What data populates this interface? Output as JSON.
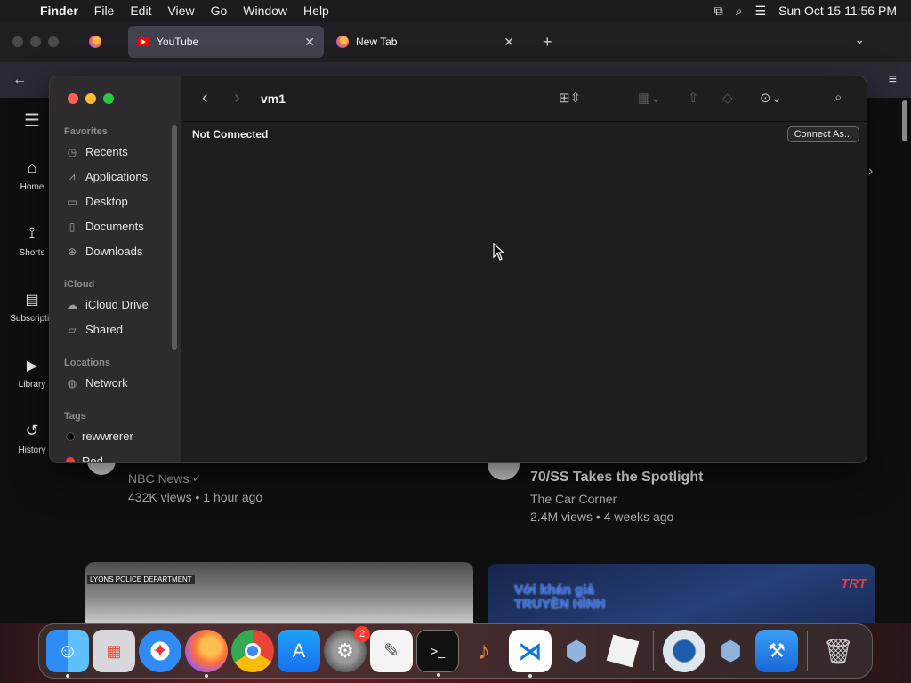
{
  "menubar": {
    "app": "Finder",
    "items": [
      "File",
      "Edit",
      "View",
      "Go",
      "Window",
      "Help"
    ],
    "datetime": "Sun Oct 15  11:56 PM"
  },
  "browser": {
    "tabs": [
      {
        "label": "YouTube",
        "active": true
      },
      {
        "label": "New Tab",
        "active": false
      }
    ]
  },
  "youtube": {
    "sidebar": [
      {
        "label": "Home",
        "icon": "home-icon"
      },
      {
        "label": "Shorts",
        "icon": "shorts-icon"
      },
      {
        "label": "Subscriptio",
        "icon": "subscriptions-icon"
      },
      {
        "label": "Library",
        "icon": "library-icon"
      },
      {
        "label": "History",
        "icon": "history-icon"
      }
    ],
    "videos": [
      {
        "channel": "NBC News",
        "meta": "432K views • 1 hour ago"
      },
      {
        "title": "70/SS Takes the Spotlight",
        "channel": "The Car Corner",
        "meta": "2.4M views • 4 weeks ago"
      }
    ],
    "thumb_a_caption": "LYONS POLICE DEPARTMENT",
    "thumb_b_text": "Với khán giả\nTRUYỀN HÌNH",
    "thumb_b_logo": "TRT"
  },
  "finder": {
    "title": "vm1",
    "status": "Not Connected",
    "connect_button": "Connect As...",
    "sections": {
      "favorites": "Favorites",
      "icloud": "iCloud",
      "locations": "Locations",
      "tags": "Tags"
    },
    "favorites": [
      "Recents",
      "Applications",
      "Desktop",
      "Documents",
      "Downloads"
    ],
    "icloud": [
      "iCloud Drive",
      "Shared"
    ],
    "locations": [
      "Network"
    ],
    "tags": [
      "rewwrerer",
      "Red"
    ]
  },
  "dock": {
    "apps": [
      "Finder",
      "Launchpad",
      "Safari",
      "Firefox",
      "Chrome",
      "App Store",
      "System Settings",
      "TextEdit",
      "Terminal",
      "GarageBand",
      "VS Code",
      "VirtualBox",
      "Roblox",
      "QuickTime",
      "VirtualBox VM",
      "Xcode",
      "Trash"
    ],
    "settings_badge": "2"
  },
  "colors": {
    "close": "#ff5f57",
    "minimize": "#febc2e",
    "zoom": "#28c840"
  }
}
